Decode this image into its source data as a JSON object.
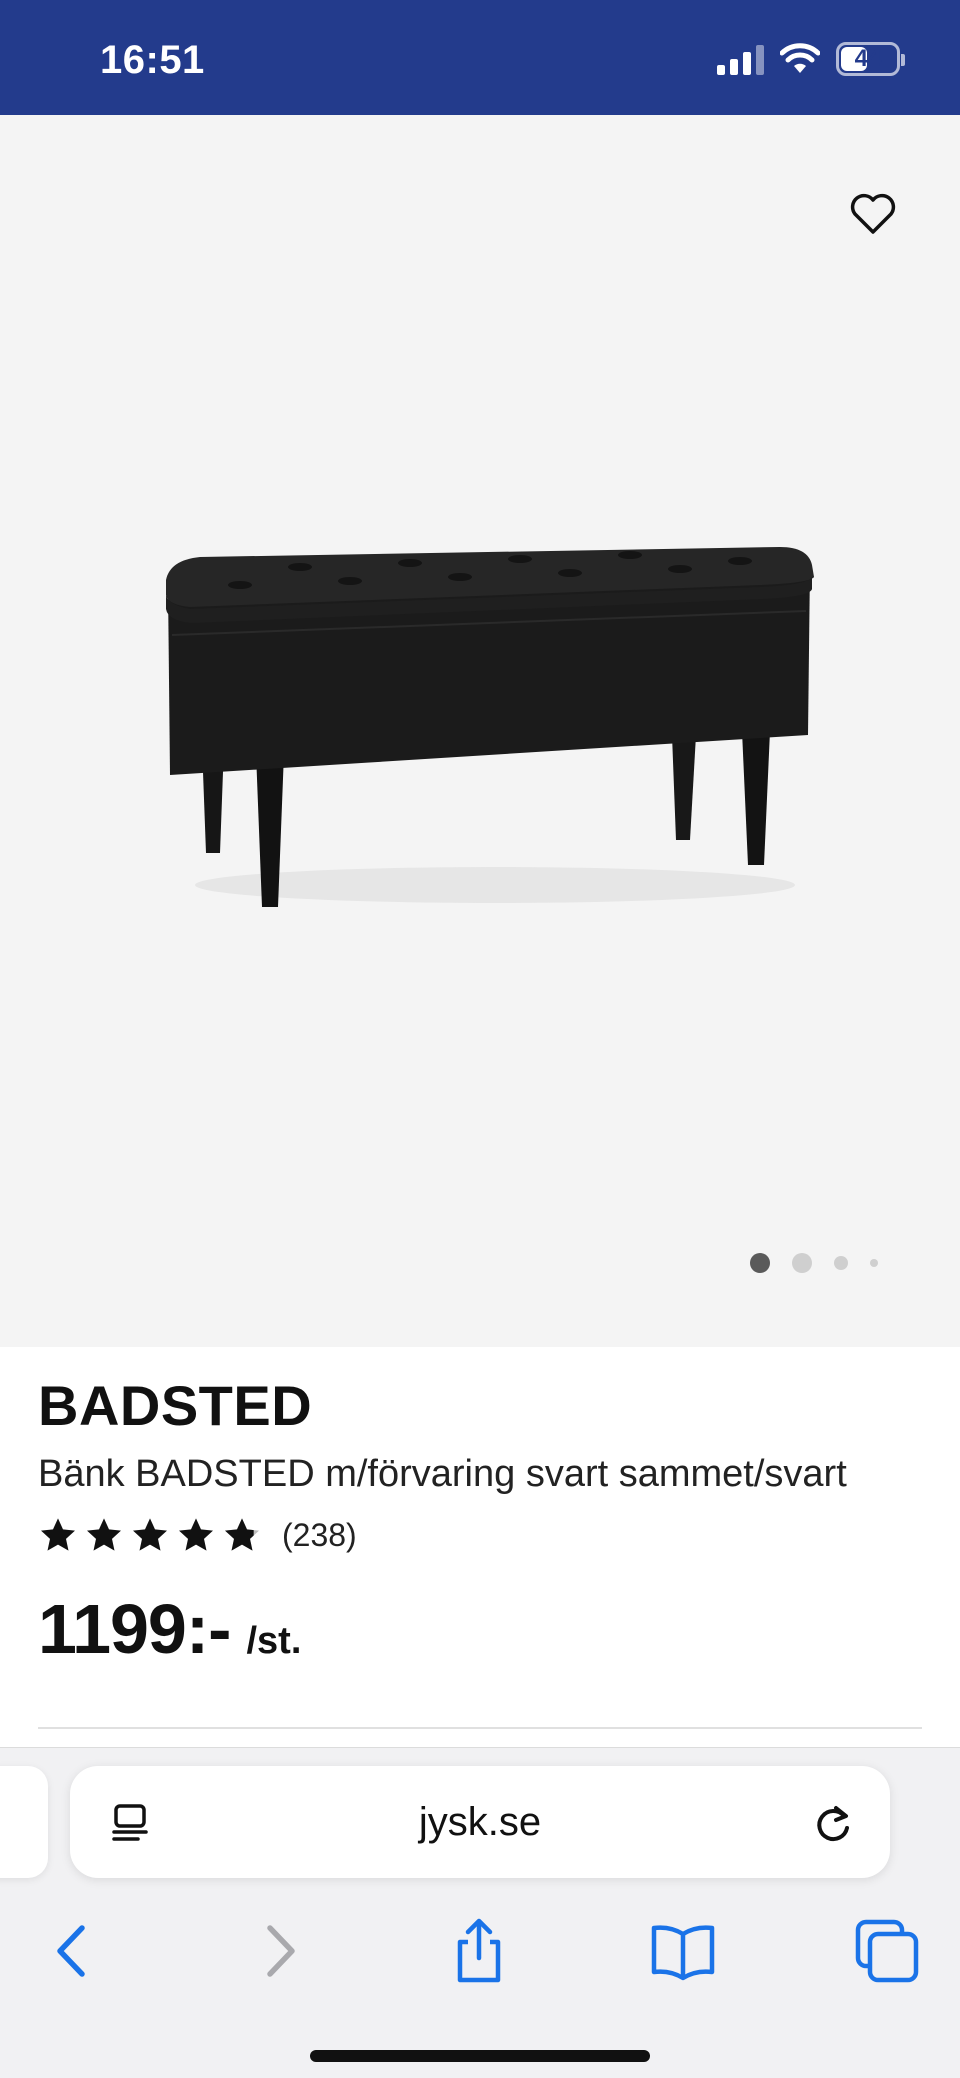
{
  "status_bar": {
    "time": "16:51",
    "battery": "44",
    "background": "#233b8c"
  },
  "gallery": {
    "favorite_icon": "heart-outline-icon",
    "image_alt": "black velvet storage bench",
    "slide_count": 4,
    "active_slide": 1
  },
  "product": {
    "brand": "BADSTED",
    "description": "Bänk BADSTED m/förvaring svart sammet/svart",
    "rating": 4.8,
    "rating_max": 5,
    "review_count": "(238)",
    "price": "1199:-",
    "price_unit": "/st."
  },
  "browser": {
    "url": "jysk.se",
    "icons": [
      "reader-icon",
      "reload-icon",
      "back-icon",
      "forward-icon",
      "share-icon",
      "bookmarks-icon",
      "tabs-icon"
    ],
    "accent": "#1a73e8"
  }
}
